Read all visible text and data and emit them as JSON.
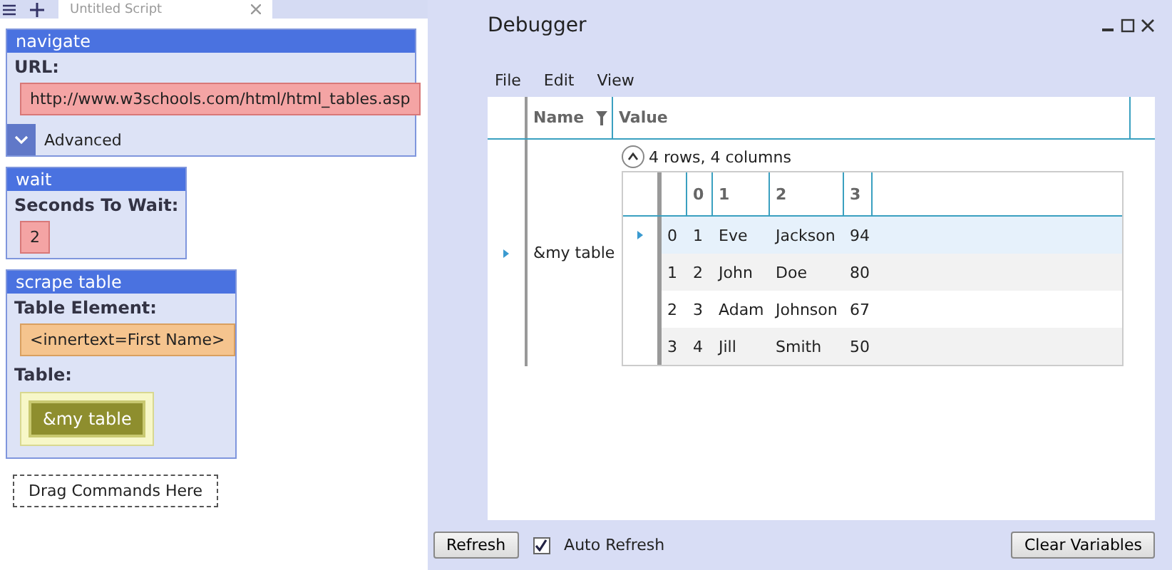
{
  "script_tabs": [
    {
      "title": "Untitled Script",
      "selected": true
    }
  ],
  "commands": [
    {
      "kind": "navigate",
      "title": "navigate",
      "fields": [
        {
          "label": "URL:",
          "value": "http://www.w3schools.com/html/html_tables.asp",
          "kind": "text"
        }
      ],
      "advanced": {
        "label": "Advanced",
        "expanded": false
      }
    },
    {
      "kind": "basic",
      "title": "wait",
      "fields": [
        {
          "label": "Seconds To Wait:",
          "value": "2",
          "kind": "text"
        }
      ]
    },
    {
      "kind": "basic",
      "title": "scrape table",
      "fields": [
        {
          "label": "Table Element:",
          "value": "<innertext=First Name>",
          "kind": "element"
        },
        {
          "label": "Table:",
          "value": "&my table",
          "kind": "variable"
        }
      ]
    }
  ],
  "drop_zone": "Drag Commands Here",
  "debugger": {
    "title": "Debugger",
    "menu": [
      "File",
      "Edit",
      "View"
    ],
    "columns": [
      {
        "label": "Name",
        "filter": true
      },
      {
        "label": "Value",
        "filter": false
      }
    ],
    "variables": [
      {
        "name": "&my table",
        "summary": "4 rows, 4 columns",
        "expanded": true,
        "table": {
          "columns": [
            "0",
            "1",
            "2",
            "3"
          ],
          "rows": [
            {
              "index": "0",
              "cells": [
                "1",
                "Eve",
                "Jackson",
                "94"
              ],
              "selected": true
            },
            {
              "index": "1",
              "cells": [
                "2",
                "John",
                "Doe",
                "80"
              ],
              "selected": false
            },
            {
              "index": "2",
              "cells": [
                "3",
                "Adam",
                "Johnson",
                "67"
              ],
              "selected": false
            },
            {
              "index": "3",
              "cells": [
                "4",
                "Jill",
                "Smith",
                "50"
              ],
              "selected": false
            }
          ]
        }
      }
    ],
    "refresh_button": "Refresh",
    "auto_refresh": {
      "label": "Auto Refresh",
      "checked": true
    },
    "clear_button": "Clear Variables"
  }
}
